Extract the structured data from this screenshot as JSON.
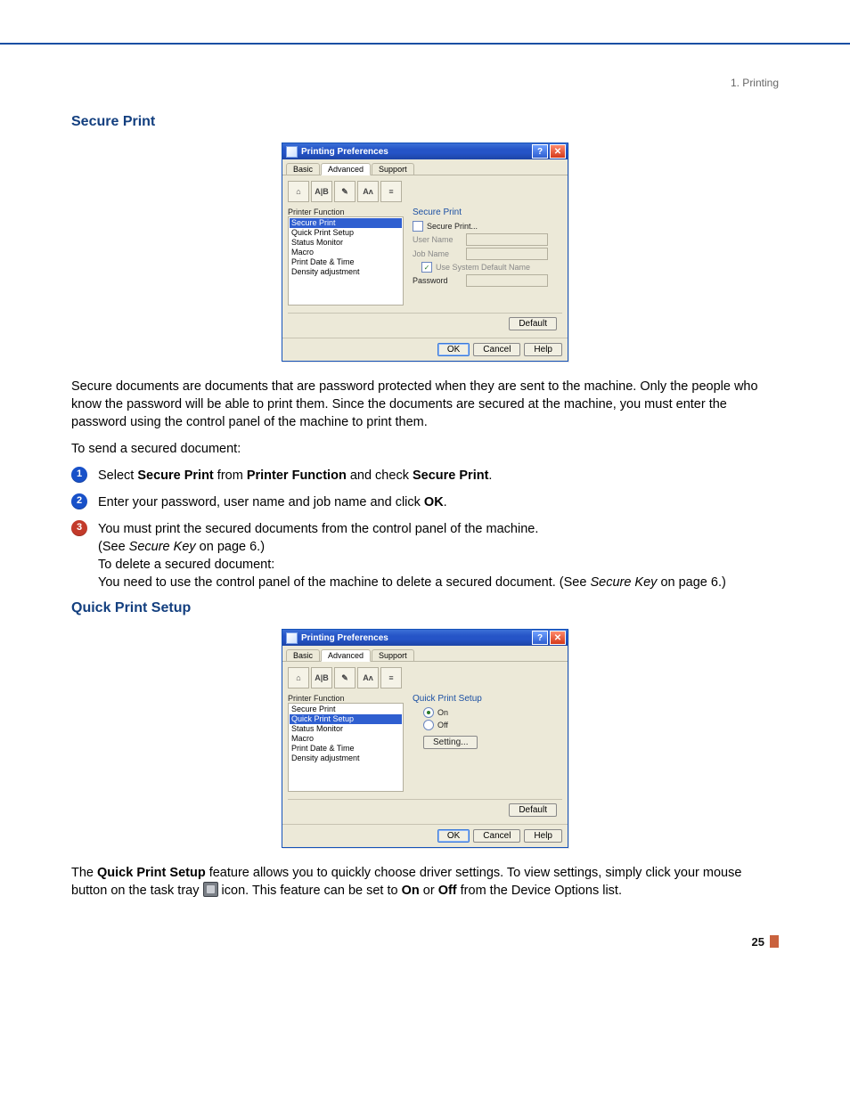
{
  "breadcrumb": "1. Printing",
  "section1_title": "Secure Print",
  "dialog": {
    "title": "Printing Preferences",
    "help_glyph": "?",
    "close_glyph": "✕",
    "tabs": {
      "basic": "Basic",
      "advanced": "Advanced",
      "support": "Support"
    },
    "toolbar_icons": [
      "⌂",
      "A|B",
      "✎",
      "Aʌ",
      "≡"
    ],
    "printer_function_label": "Printer Function",
    "function_list": [
      "Secure Print",
      "Quick Print Setup",
      "Status Monitor",
      "Macro",
      "Print Date & Time",
      "Density adjustment"
    ],
    "secure_print": {
      "heading": "Secure Print",
      "checkbox_label": "Secure Print...",
      "user_name_label": "User Name",
      "job_name_label": "Job Name",
      "default_name_checkbox": "Use System Default Name",
      "default_name_checked_glyph": "✓",
      "password_label": "Password"
    },
    "quick_print_setup": {
      "heading": "Quick Print Setup",
      "on_label": "On",
      "off_label": "Off",
      "setting_btn": "Setting..."
    },
    "default_btn": "Default",
    "ok_btn": "OK",
    "cancel_btn": "Cancel",
    "help_btn": "Help"
  },
  "para_secure_intro": "Secure documents are documents that are password protected when they are sent to the machine. Only the people who know the password will be able to print them. Since the documents are secured at the machine, you must enter the password using the control panel of the machine to print them.",
  "para_to_send": "To send a secured document:",
  "step1_pre": "Select ",
  "step1_b1": "Secure Print",
  "step1_mid": " from ",
  "step1_b2": "Printer Function",
  "step1_mid2": " and check ",
  "step1_b3": "Secure Print",
  "step1_post": ".",
  "step2_pre": "Enter your password, user name and job name and click ",
  "step2_b": "OK",
  "step2_post": ".",
  "step3_l1": "You must print the secured documents from the control panel of the machine.",
  "step3_l2a": "(See ",
  "step3_l2i": "Secure Key",
  "step3_l2b": " on page 6.)",
  "step3_l3": "To delete a secured document:",
  "step3_l4a": "You need to use the control panel of the machine to delete a secured document. (See ",
  "step3_l4i": "Secure Key",
  "step3_l4b": " on page 6.)",
  "section2_title": "Quick Print Setup",
  "para_qps_a": "The ",
  "para_qps_b": "Quick Print Setup",
  "para_qps_c": " feature allows you to quickly choose driver settings. To view settings, simply click your mouse button on the task tray ",
  "para_qps_d": " icon. This feature can be set to ",
  "para_qps_on": "On",
  "para_qps_e": " or ",
  "para_qps_off": "Off",
  "para_qps_f": " from the Device Options list.",
  "page_number": "25"
}
